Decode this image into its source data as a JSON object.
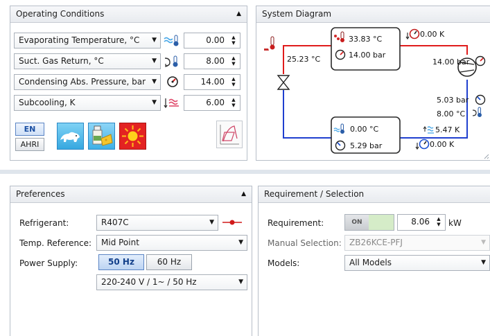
{
  "operating": {
    "title": "Operating Conditions",
    "rows": [
      {
        "label": "Evaporating Temperature, °C",
        "value": "0.00"
      },
      {
        "label": "Suct. Gas Return, °C",
        "value": "8.00"
      },
      {
        "label": "Condensing Abs. Pressure, bar",
        "value": "14.00"
      },
      {
        "label": "Subcooling, K",
        "value": "6.00"
      }
    ],
    "lang_en": "EN",
    "lang_ahri": "AHRI"
  },
  "diagram": {
    "title": "System Diagram",
    "cond_temp": "33.83 °C",
    "cond_pressure": "14.00 bar",
    "top_k": "0.00 K",
    "liquid_temp": "25.23 °C",
    "comp_discharge": "14.00 bar",
    "comp_suction": "5.03 bar",
    "suction_temp": "8.00 °C",
    "evap_temp": "0.00 °C",
    "evap_pressure": "5.29 bar",
    "superheat": "5.47 K",
    "bottom_k": "0.00 K"
  },
  "preferences": {
    "title": "Preferences",
    "refrigerant_label": "Refrigerant:",
    "refrigerant_value": "R407C",
    "temp_ref_label": "Temp. Reference:",
    "temp_ref_value": "Mid Point",
    "power_label": "Power Supply:",
    "hz50": "50 Hz",
    "hz60": "60 Hz",
    "voltage": "220-240 V / 1~ / 50 Hz"
  },
  "requirement": {
    "title": "Requirement / Selection",
    "req_label": "Requirement:",
    "toggle": "ON",
    "req_value": "8.06",
    "unit": "kW",
    "manual_label": "Manual Selection:",
    "manual_value": "ZB26KCE-PFJ",
    "models_label": "Models:",
    "models_value": "All Models"
  },
  "colors": {
    "hot_line": "#e01b1b",
    "cold_line": "#1f3fcf",
    "accent": "#1a74d1"
  }
}
